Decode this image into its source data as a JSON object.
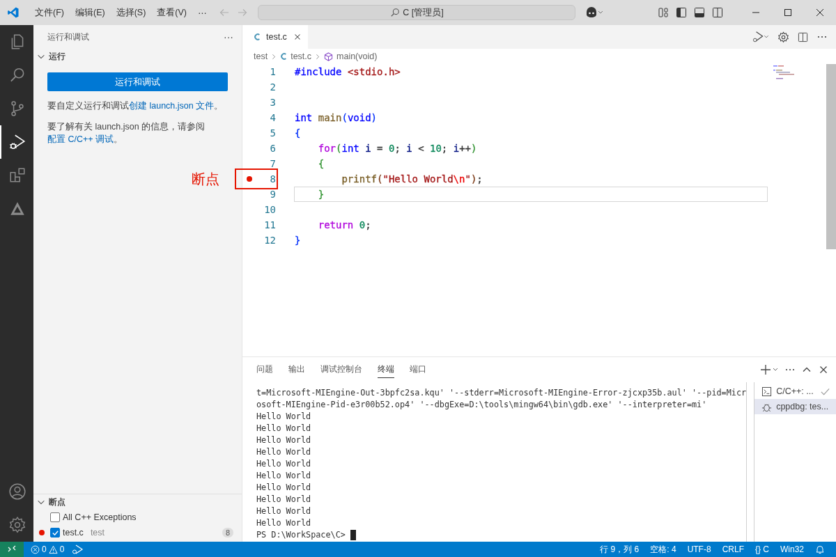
{
  "title_bar": {
    "menus": [
      "文件(F)",
      "编辑(E)",
      "选择(S)",
      "查看(V)",
      "⋯"
    ],
    "search": {
      "value": "C [管理员]"
    }
  },
  "activity_bar": {
    "items": [
      {
        "kind": "files",
        "selected": false
      },
      {
        "kind": "search",
        "selected": false
      },
      {
        "kind": "source-control",
        "selected": false
      },
      {
        "kind": "run-debug",
        "selected": true
      },
      {
        "kind": "extensions",
        "selected": false
      },
      {
        "kind": "triangle",
        "selected": false
      }
    ]
  },
  "sidebar": {
    "title": "运行和调试",
    "more": "···",
    "run_section": {
      "title": "运行",
      "expanded": true,
      "button": "运行和调试",
      "text_1": "要自定义运行和调试",
      "link_1": "创建 launch.json 文件",
      "text_1_end": "。",
      "text_2": "要了解有关 launch.json 的信息，请参阅 ",
      "link_2": "配置 C/C++ 调试",
      "text_2_end": "。"
    },
    "breakpoints": {
      "title": "断点",
      "expanded": true,
      "items": [
        {
          "label": "All C++ Exceptions",
          "checked": false,
          "dot": false
        },
        {
          "label": "test.c",
          "detail": "test",
          "count": "8",
          "checked": true,
          "dot": true
        }
      ]
    }
  },
  "editor": {
    "tabs": [
      {
        "label": "test.c",
        "selected": true
      }
    ],
    "breadcrumbs": [
      "test",
      "test.c",
      "main(void)"
    ],
    "lines": [
      {
        "n": "1",
        "breakpoint": false,
        "current": false,
        "tokens": [
          {
            "t": "#include ",
            "color": "#0000ff"
          },
          {
            "t": "<stdio.h>",
            "color": "#a31515"
          }
        ]
      },
      {
        "n": "2",
        "breakpoint": false,
        "current": false
      },
      {
        "n": "3",
        "breakpoint": false,
        "current": false
      },
      {
        "n": "4",
        "breakpoint": false,
        "current": false,
        "tokens": [
          {
            "t": "int ",
            "color": "#0000ff"
          },
          {
            "t": "main",
            "color": "#795e26"
          },
          {
            "t": "(",
            "color": "#0431fa"
          },
          {
            "t": "void",
            "color": "#0000ff"
          },
          {
            "t": ")",
            "color": "#0431fa"
          }
        ]
      },
      {
        "n": "5",
        "breakpoint": false,
        "current": false,
        "tokens": [
          {
            "t": "{",
            "color": "#0431fa"
          }
        ]
      },
      {
        "n": "6",
        "breakpoint": false,
        "current": false,
        "tokens": [
          {
            "t": "    for",
            "color": "#af00db"
          },
          {
            "t": "(",
            "color": "#319331"
          },
          {
            "t": "int ",
            "color": "#0000ff"
          },
          {
            "t": "i",
            "color": "#001080"
          },
          {
            "t": " = "
          },
          {
            "t": "0",
            "color": "#098658"
          },
          {
            "t": "; "
          },
          {
            "t": "i",
            "color": "#001080"
          },
          {
            "t": " < "
          },
          {
            "t": "10",
            "color": "#098658"
          },
          {
            "t": "; "
          },
          {
            "t": "i",
            "color": "#001080"
          },
          {
            "t": "++"
          },
          {
            "t": ")",
            "color": "#319331"
          }
        ]
      },
      {
        "n": "7",
        "breakpoint": false,
        "current": false,
        "tokens": [
          {
            "t": "    {",
            "color": "#319331"
          }
        ]
      },
      {
        "n": "8",
        "breakpoint": true,
        "current": false,
        "tokens": [
          {
            "t": "        printf",
            "color": "#795e26"
          },
          {
            "t": "(",
            "color": "#7b3814"
          },
          {
            "t": "\"Hello World",
            "color": "#a31515"
          },
          {
            "t": "\\n",
            "color": "#ee0000"
          },
          {
            "t": "\"",
            "color": "#a31515"
          },
          {
            "t": ")",
            "color": "#7b3814"
          },
          {
            "t": ";"
          }
        ]
      },
      {
        "n": "9",
        "breakpoint": false,
        "current": true,
        "tokens": [
          {
            "t": "    }",
            "color": "#319331"
          }
        ]
      },
      {
        "n": "10",
        "breakpoint": false,
        "current": false
      },
      {
        "n": "11",
        "breakpoint": false,
        "current": false,
        "tokens": [
          {
            "t": "    return ",
            "color": "#af00db"
          },
          {
            "t": "0",
            "color": "#098658"
          },
          {
            "t": ";"
          }
        ]
      },
      {
        "n": "12",
        "breakpoint": false,
        "current": false,
        "tokens": [
          {
            "t": "}",
            "color": "#0431fa"
          }
        ]
      }
    ]
  },
  "annotation": {
    "label": "断点"
  },
  "panel": {
    "tabs": [
      {
        "label": "问题",
        "selected": false
      },
      {
        "label": "输出",
        "selected": false
      },
      {
        "label": "调试控制台",
        "selected": false
      },
      {
        "label": "终端",
        "selected": true
      },
      {
        "label": "端口",
        "selected": false
      }
    ],
    "terminal_lines": [
      "t=Microsoft-MIEngine-Out-3bpfc2sa.kqu' '--stderr=Microsoft-MIEngine-Error-zjcxp35b.aul' '--pid=Micr",
      "osoft-MIEngine-Pid-e3r00b52.op4' '--dbgExe=D:\\tools\\mingw64\\bin\\gdb.exe' '--interpreter=mi'",
      "Hello World",
      "Hello World",
      "Hello World",
      "Hello World",
      "Hello World",
      "Hello World",
      "Hello World",
      "Hello World",
      "Hello World",
      "Hello World"
    ],
    "prompt": "PS D:\\WorkSpace\\C> ",
    "terminals": [
      {
        "kind": "shell",
        "label": "C/C++: ...",
        "done": true,
        "selected": false
      },
      {
        "kind": "debug",
        "label": "cppdbg: tes...",
        "done": false,
        "selected": true
      }
    ]
  },
  "status_bar": {
    "errors": "0",
    "warnings": "0",
    "right": [
      "行 9，列 6",
      "空格: 4",
      "UTF-8",
      "CRLF",
      "{} C",
      "Win32"
    ]
  }
}
